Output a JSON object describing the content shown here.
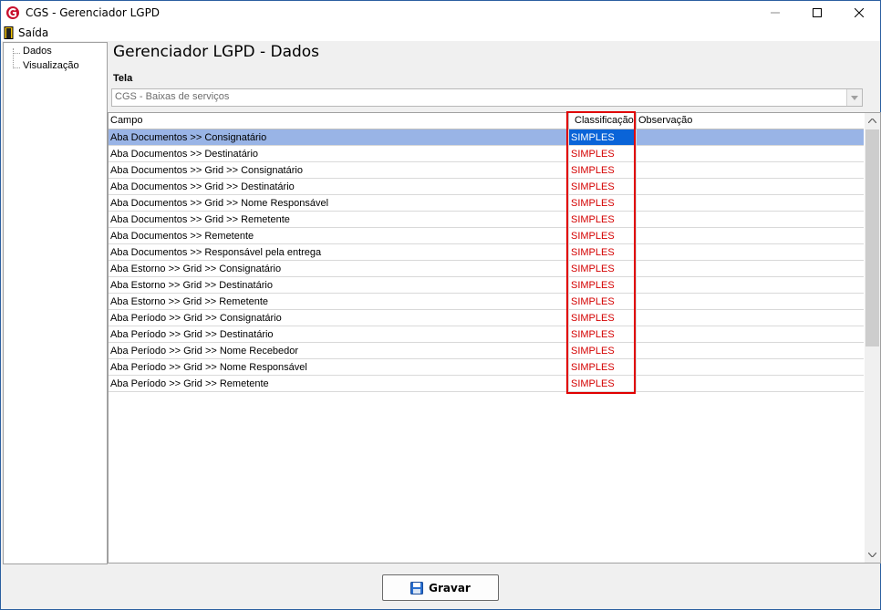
{
  "window": {
    "title": "CGS - Gerenciador LGPD"
  },
  "menu": {
    "exit_label": "Saída"
  },
  "tree": {
    "items": [
      "Dados",
      "Visualização"
    ]
  },
  "page": {
    "title": "Gerenciador LGPD - Dados"
  },
  "screen_field": {
    "label": "Tela",
    "value": "CGS - Baixas de serviços"
  },
  "grid": {
    "columns": [
      "Campo",
      "Classificação",
      "Observação"
    ],
    "rows": [
      {
        "campo": "Aba Documentos >> Consignatário",
        "classificacao": "SIMPLES",
        "observacao": ""
      },
      {
        "campo": "Aba Documentos >> Destinatário",
        "classificacao": "SIMPLES",
        "observacao": ""
      },
      {
        "campo": "Aba Documentos >> Grid >> Consignatário",
        "classificacao": "SIMPLES",
        "observacao": ""
      },
      {
        "campo": "Aba Documentos >> Grid >> Destinatário",
        "classificacao": "SIMPLES",
        "observacao": ""
      },
      {
        "campo": "Aba Documentos >> Grid >> Nome Responsável",
        "classificacao": "SIMPLES",
        "observacao": ""
      },
      {
        "campo": "Aba Documentos >> Grid >> Remetente",
        "classificacao": "SIMPLES",
        "observacao": ""
      },
      {
        "campo": "Aba Documentos >> Remetente",
        "classificacao": "SIMPLES",
        "observacao": ""
      },
      {
        "campo": "Aba Documentos >> Responsável pela entrega",
        "classificacao": "SIMPLES",
        "observacao": ""
      },
      {
        "campo": "Aba Estorno >> Grid >> Consignatário",
        "classificacao": "SIMPLES",
        "observacao": ""
      },
      {
        "campo": "Aba Estorno >> Grid >> Destinatário",
        "classificacao": "SIMPLES",
        "observacao": ""
      },
      {
        "campo": "Aba Estorno >> Grid >> Remetente",
        "classificacao": "SIMPLES",
        "observacao": ""
      },
      {
        "campo": "Aba Período >> Grid >> Consignatário",
        "classificacao": "SIMPLES",
        "observacao": ""
      },
      {
        "campo": "Aba Período >> Grid >> Destinatário",
        "classificacao": "SIMPLES",
        "observacao": ""
      },
      {
        "campo": "Aba Período >> Grid >> Nome Recebedor",
        "classificacao": "SIMPLES",
        "observacao": ""
      },
      {
        "campo": "Aba Período >> Grid >> Nome Responsável",
        "classificacao": "SIMPLES",
        "observacao": ""
      },
      {
        "campo": "Aba Período >> Grid >> Remetente",
        "classificacao": "SIMPLES",
        "observacao": ""
      }
    ],
    "selected_index": 0
  },
  "actions": {
    "save_label": "Gravar"
  },
  "colors": {
    "classification_text": "#d40000",
    "selection": "#99b4e6",
    "highlight_border": "#e00000"
  }
}
